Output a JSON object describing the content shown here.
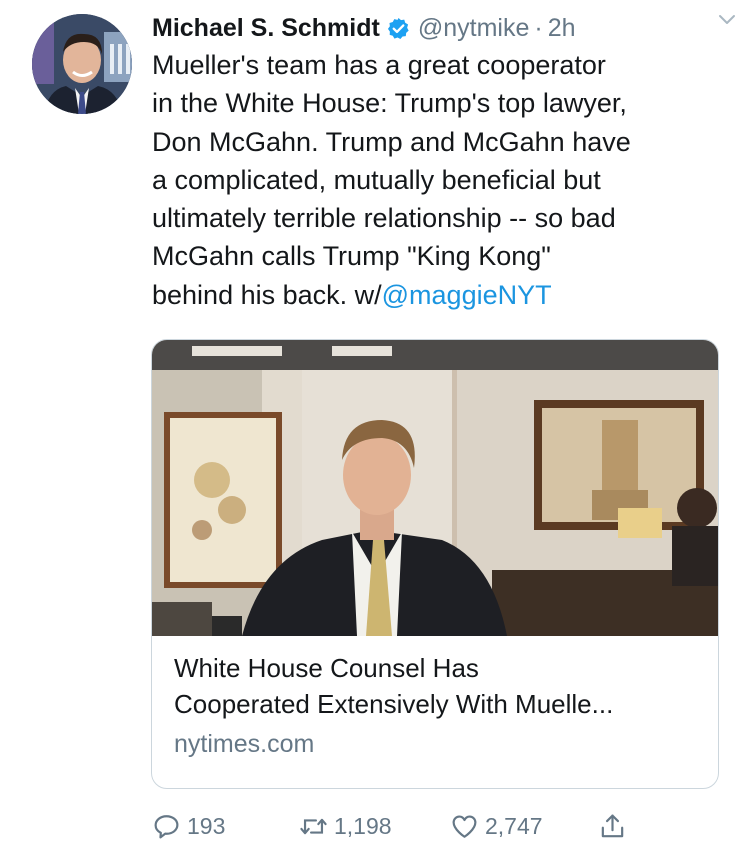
{
  "tweet": {
    "author_name": "Michael S. Schmidt",
    "handle": "@nytmike",
    "separator": "·",
    "time": "2h",
    "text_lines": [
      "Mueller's team has a great cooperator",
      "in the White House: Trump's top lawyer,",
      "Don McGahn. Trump and McGahn have",
      "a complicated, mutually beneficial but",
      "ultimately terrible relationship -- so bad",
      "McGahn calls Trump \"King Kong\"",
      "behind his back. w/"
    ],
    "mention": "@maggieNYT"
  },
  "card": {
    "title_lines": [
      "White House Counsel Has",
      "Cooperated Extensively With Muelle..."
    ],
    "domain": "nytimes.com"
  },
  "actions": {
    "reply_count": "193",
    "retweet_count": "1,198",
    "like_count": "2,747"
  },
  "icons": {
    "verified": "verified-badge-icon",
    "caret": "chevron-down-icon",
    "reply": "reply-icon",
    "retweet": "retweet-icon",
    "like": "heart-icon",
    "share": "share-icon"
  },
  "colors": {
    "link": "#1b95e0",
    "secondary_text": "#657786",
    "verified": "#1da1f2",
    "border": "#ccd6dd"
  }
}
